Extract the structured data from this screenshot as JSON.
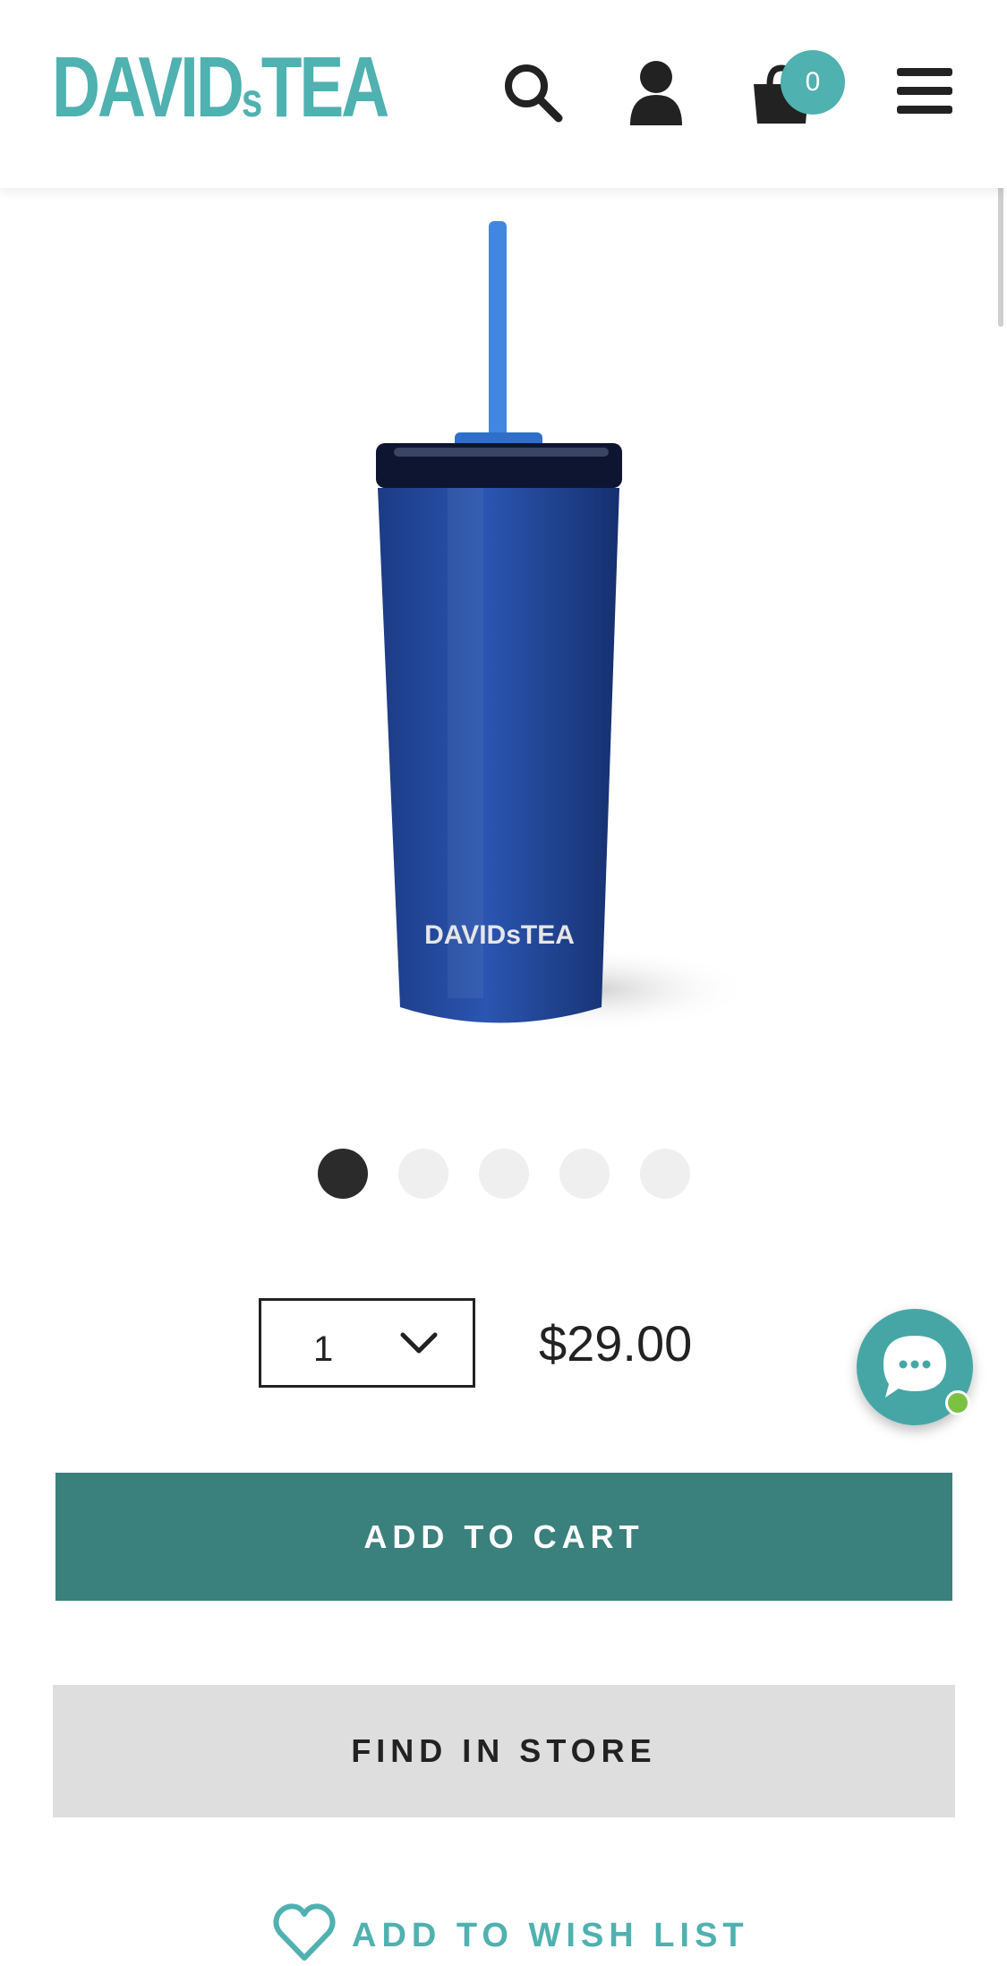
{
  "header": {
    "logo_text": "DAVIDsTEA",
    "logo_main_left": "DAVID",
    "logo_small": "s",
    "logo_main_right": "TEA",
    "cart_count": "0",
    "icons": [
      "search-icon",
      "account-icon",
      "cart-icon",
      "menu-icon"
    ]
  },
  "product": {
    "image_alt": "Blue tumbler with straw",
    "tumbler_logo_text": "DAVIDsTEA",
    "carousel": {
      "total_slides": 5,
      "active_index": 0
    }
  },
  "purchase": {
    "quantity": "1",
    "price": "$29.00",
    "add_to_cart_label": "ADD TO CART",
    "find_in_store_label": "FIND IN STORE",
    "wish_list_label": "ADD TO WISH LIST"
  },
  "chat": {
    "status": "online"
  },
  "colors": {
    "brand_teal": "#4fb1b0",
    "button_teal": "#3a807c",
    "secondary_button": "#dedede",
    "text_dark": "#222222",
    "online_green": "#7cc142"
  }
}
